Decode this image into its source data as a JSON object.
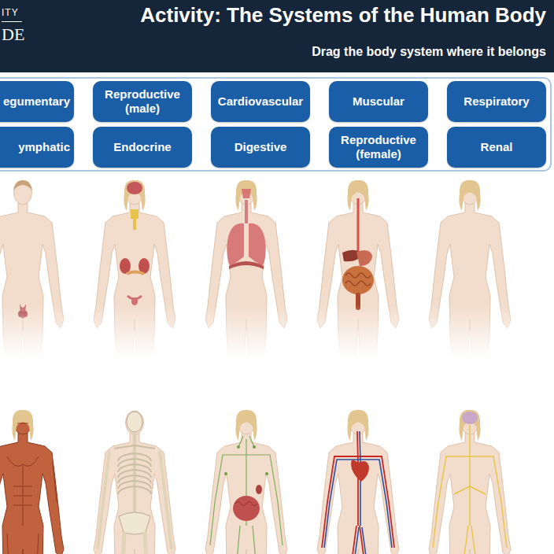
{
  "header": {
    "logo": {
      "line1": "ITY",
      "line2": "DE"
    },
    "title": "Activity: The Systems of the Human Body",
    "subtitle": "Drag the body system where it belongs"
  },
  "system_buttons": [
    "egumentary",
    "Reproductive (male)",
    "Cardiovascular",
    "Muscular",
    "Respiratory",
    "ymphatic",
    "Endocrine",
    "Digestive",
    "Reproductive (female)",
    "Renal"
  ]
}
